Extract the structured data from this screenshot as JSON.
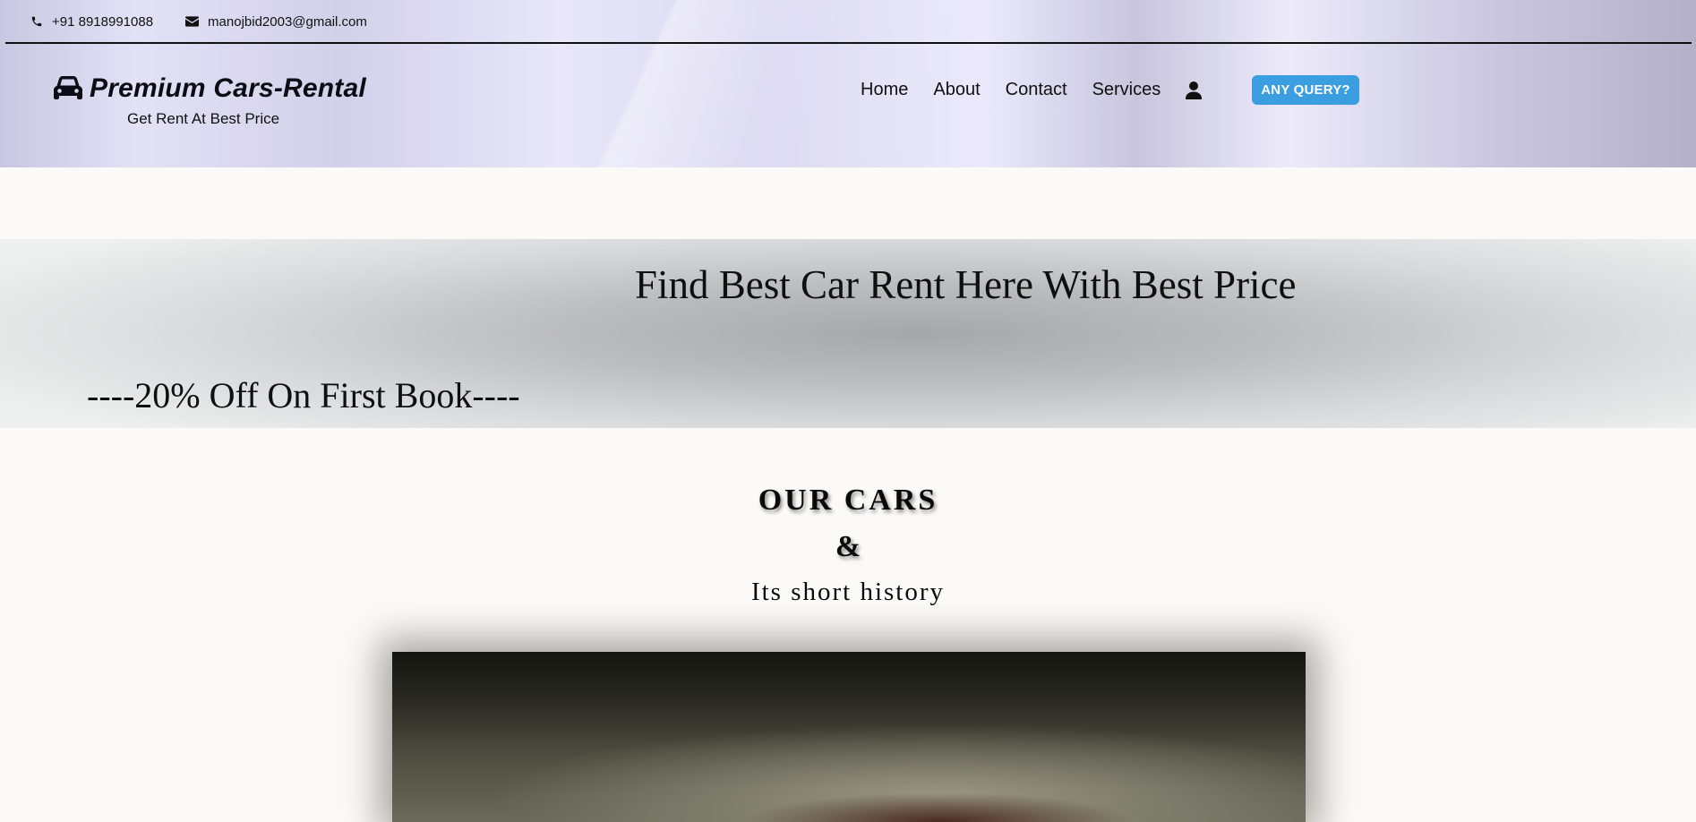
{
  "topbar": {
    "phone": "+91 8918991088",
    "email": "manojbid2003@gmail.com"
  },
  "brand": {
    "title": "Premium Cars-Rental",
    "tagline": "Get Rent At Best Price"
  },
  "nav": {
    "items": [
      "Home",
      "About",
      "Contact",
      "Services"
    ],
    "query_button": "ANY QUERY?"
  },
  "hero": {
    "title": "Find Best Car Rent Here With Best Price",
    "offer": "----20% Off On First Book----"
  },
  "section": {
    "heading": "OUR CARS",
    "ampersand": "&",
    "subheading": "Its short history"
  },
  "icons": {
    "phone": "phone-icon",
    "email": "envelope-icon",
    "brand": "car-icon",
    "user": "user-icon"
  },
  "colors": {
    "accent": "#3b9ee0",
    "background": "#fcfaf6"
  }
}
